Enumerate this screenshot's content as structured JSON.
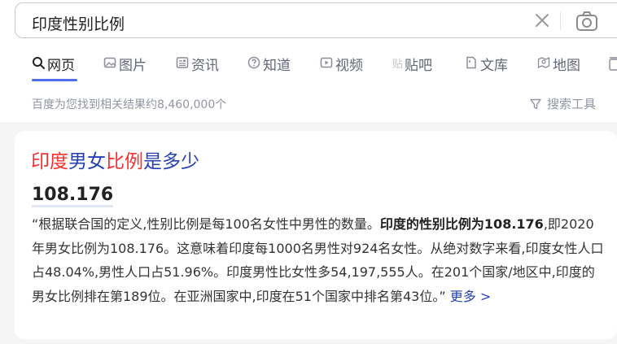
{
  "search": {
    "query": "印度性别比例"
  },
  "tabs": [
    {
      "label": "网页",
      "icon": "search-icon",
      "active": true
    },
    {
      "label": "图片",
      "icon": "image-icon",
      "active": false
    },
    {
      "label": "资讯",
      "icon": "news-icon",
      "active": false
    },
    {
      "label": "知道",
      "icon": "question-icon",
      "active": false
    },
    {
      "label": "视频",
      "icon": "video-icon",
      "active": false
    },
    {
      "label": "贴吧",
      "icon": "tieba-icon",
      "active": false
    },
    {
      "label": "文库",
      "icon": "document-icon",
      "active": false
    },
    {
      "label": "地图",
      "icon": "map-icon",
      "active": false
    }
  ],
  "stats": {
    "text": "百度为您找到相关结果约8,460,000个",
    "tools_label": "搜索工具"
  },
  "result": {
    "title_parts": [
      "印度",
      "男女",
      "比例",
      "是多少"
    ],
    "answer": "108.176",
    "snippet_pre": "“根据联合国的定义,性别比例是每100名女性中男性的数量。",
    "snippet_bold": "印度的性别比例为108.176",
    "snippet_post": ",即2020年男女比例为108.176。这意味着印度每1000名男性对924名女性。从绝对数字来看,印度女性人口占48.04%,男性人口占51.96%。印度男性比女性多54,197,555人。在201个国家/地区中,印度的男女比例排在第189位。在亚洲国家中,印度在51个国家中排名第43位。”",
    "more_label": "更多 >"
  },
  "colors": {
    "accent": "#4e6ef2",
    "link": "#2440b3",
    "highlight": "#f73131",
    "muted": "#9195a3"
  }
}
